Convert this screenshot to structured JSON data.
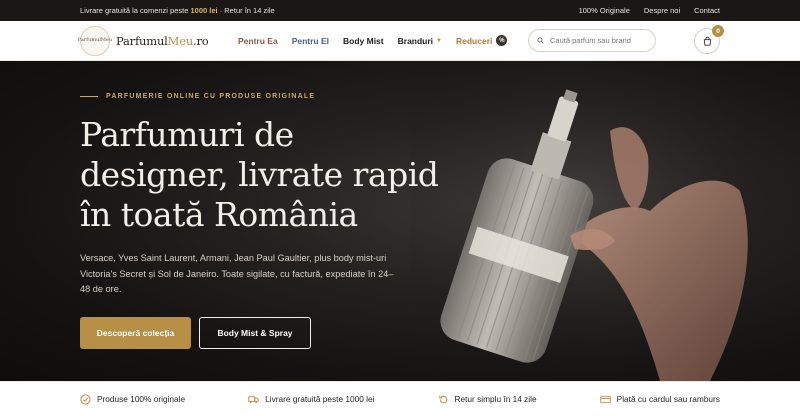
{
  "topbar": {
    "promo_prefix": "Livrare gratuită la comenzi peste",
    "promo_amount": "1000 lei",
    "promo_suffix": "· Retur în 14 zile",
    "links": [
      "100% Originale",
      "Despre noi",
      "Contact"
    ]
  },
  "header": {
    "logo_badge_text": "ParfumulMeu",
    "logo_main": "Parfumul",
    "logo_accent": "Meu",
    "logo_tld": ".ro",
    "nav": {
      "pentru_ea": "Pentru Ea",
      "pentru_el": "Pentru El",
      "body_mist": "Body Mist",
      "branduri": "Branduri",
      "reduceri": "Reduceri",
      "reduceri_badge": "%"
    },
    "search_placeholder": "Caută parfum sau brand",
    "cart_count": "0"
  },
  "hero": {
    "eyebrow": "PARFUMERIE ONLINE CU PRODUSE ORIGINALE",
    "headline_line1": "Parfumuri de",
    "headline_line2": "designer, livrate rapid",
    "headline_line3": "în toată România",
    "description": "Versace, Yves Saint Laurent, Armani, Jean Paul Gaultier, plus body mist-uri Victoria's Secret și Sol de Janeiro. Toate sigilate, cu factură, expediate în 24–48 de ore.",
    "cta_primary": "Descoperă colecția",
    "cta_secondary": "Body Mist & Spray"
  },
  "features": {
    "original": "Produse 100% originale",
    "shipping": "Livrare gratuită peste 1000 lei",
    "returns": "Retur simplu în 14 zile",
    "payment": "Plată cu cardul sau ramburs"
  },
  "colors": {
    "accent": "#b88f46",
    "dark": "#1b1714",
    "hero_bg": "#151312"
  },
  "icons": [
    "search-icon",
    "cart-icon",
    "check-circle-icon",
    "truck-icon",
    "return-icon",
    "card-icon",
    "chevron-down-icon"
  ]
}
